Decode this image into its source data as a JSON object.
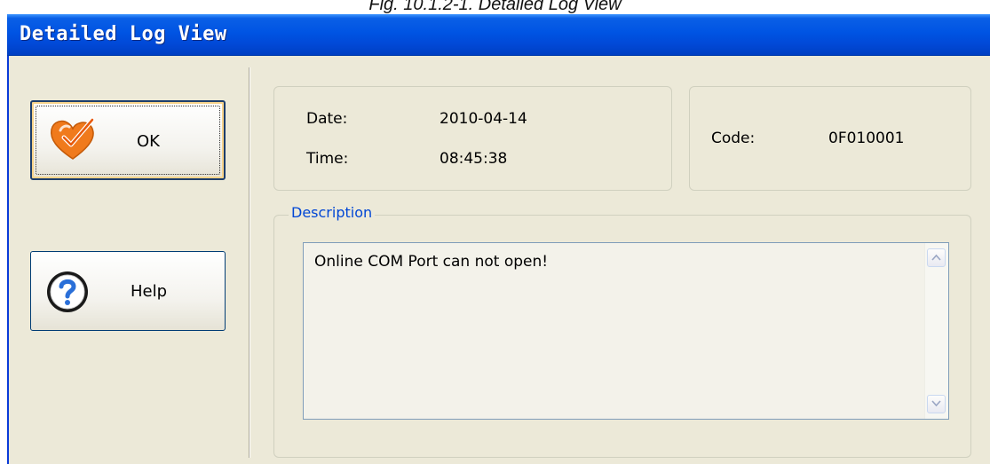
{
  "caption": "Fig. 10.1.2-1. Detailed Log View",
  "window": {
    "title": "Detailed Log View"
  },
  "buttons": {
    "ok": {
      "label": "OK",
      "icon": "heart-check-icon"
    },
    "help": {
      "label": "Help",
      "icon": "question-icon"
    }
  },
  "log": {
    "date_label": "Date:",
    "date": "2010-04-14",
    "time_label": "Time:",
    "time": "08:45:38",
    "code_label": "Code:",
    "code": "0F010001"
  },
  "description": {
    "legend": "Description",
    "text": "Online COM Port can not open!"
  },
  "colors": {
    "titlebar": "#0054e3",
    "window_bg": "#ece9d8",
    "legend": "#0046d5",
    "ok_icon": "#f07a1c"
  }
}
